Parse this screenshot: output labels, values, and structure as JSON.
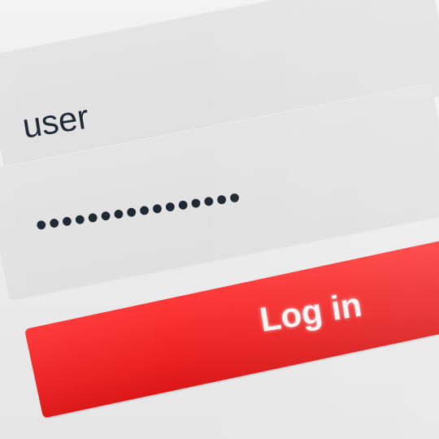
{
  "login_form": {
    "username_value": "user",
    "password_value": "••••••••••••••••",
    "login_button_label": "Log in"
  },
  "colors": {
    "background": "#ededed",
    "field": "#e2e2e2",
    "text": "#1f2733",
    "accent": "#ea2424",
    "button_text": "#fff2f2"
  }
}
